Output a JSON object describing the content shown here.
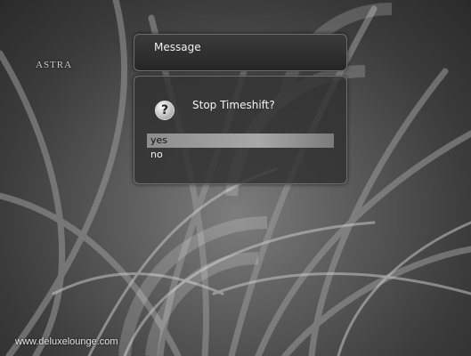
{
  "background": {
    "channel_logo": "ASTRA",
    "watermark": "www.deluxelounge.com"
  },
  "dialog": {
    "title": "Message",
    "icon": "question-icon",
    "question_mark": "?",
    "question": "Stop Timeshift?",
    "options": [
      {
        "label": "yes",
        "selected": true
      },
      {
        "label": "no",
        "selected": false
      }
    ]
  },
  "colors": {
    "dialog_bg": "#262626",
    "selection": "#a8a8a8",
    "text": "#f4f4f4"
  }
}
